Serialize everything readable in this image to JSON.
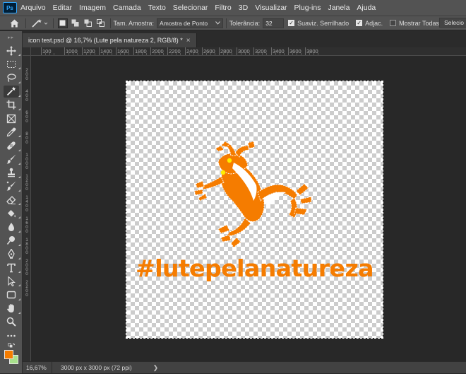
{
  "menubar": {
    "logo": "Ps",
    "items": [
      "Arquivo",
      "Editar",
      "Imagem",
      "Camada",
      "Texto",
      "Selecionar",
      "Filtro",
      "3D",
      "Visualizar",
      "Plug-ins",
      "Janela",
      "Ajuda"
    ]
  },
  "options": {
    "sample_size_label": "Tam. Amostra:",
    "sample_size_value": "Amostra de Ponto",
    "tolerance_label": "Tolerância:",
    "tolerance_value": "32",
    "antialias_label": "Suaviz. Serrilhado",
    "antialias_checked": true,
    "contiguous_label": "Adjac.",
    "contiguous_checked": true,
    "sample_all_label": "Mostrar Todas Camad.",
    "sample_all_checked": false,
    "select_subject_label": "Selecio"
  },
  "document_tab": {
    "title": "icon test.psd @ 16,7% (Lute pela natureza 2, RGB/8) *",
    "close_glyph": "×"
  },
  "tools": [
    {
      "name": "move-tool",
      "icon": "move-icon"
    },
    {
      "name": "marquee-tool",
      "icon": "marquee-icon"
    },
    {
      "name": "lasso-tool",
      "icon": "lasso-icon"
    },
    {
      "name": "magic-wand-tool",
      "icon": "magic-wand-icon",
      "active": true
    },
    {
      "name": "crop-tool",
      "icon": "crop-icon"
    },
    {
      "name": "frame-tool",
      "icon": "frame-icon"
    },
    {
      "name": "eyedropper-tool",
      "icon": "eyedropper-icon"
    },
    {
      "name": "healing-brush-tool",
      "icon": "bandage-icon"
    },
    {
      "name": "brush-tool",
      "icon": "brush-icon"
    },
    {
      "name": "clone-stamp-tool",
      "icon": "stamp-icon"
    },
    {
      "name": "history-brush-tool",
      "icon": "history-brush-icon"
    },
    {
      "name": "eraser-tool",
      "icon": "eraser-icon"
    },
    {
      "name": "paint-bucket-tool",
      "icon": "bucket-icon"
    },
    {
      "name": "blur-tool",
      "icon": "drop-icon"
    },
    {
      "name": "dodge-tool",
      "icon": "dodge-icon"
    },
    {
      "name": "pen-tool",
      "icon": "pen-icon"
    },
    {
      "name": "type-tool",
      "icon": "type-icon"
    },
    {
      "name": "path-selection-tool",
      "icon": "arrow-icon"
    },
    {
      "name": "shape-tool",
      "icon": "rectangle-icon"
    },
    {
      "name": "hand-tool",
      "icon": "hand-icon"
    },
    {
      "name": "zoom-tool",
      "icon": "zoom-icon"
    },
    {
      "name": "more-tools",
      "icon": "ellipsis-icon"
    }
  ],
  "colors": {
    "foreground": "#f57c00",
    "background": "#a8e08c",
    "accent": "#31a8ff",
    "artwork": "#f57c00"
  },
  "ruler_top": {
    "labels": [
      "100",
      "1000",
      "1200",
      "1400",
      "1600",
      "1800",
      "2000",
      "2200",
      "2400",
      "2600",
      "2800",
      "3000",
      "3200",
      "3400",
      "3600",
      "3800"
    ]
  },
  "ruler_left": {
    "labels": [
      "200",
      "400",
      "600",
      "800",
      "1000",
      "1200",
      "1400",
      "1600",
      "1800",
      "2000",
      "2200"
    ]
  },
  "artwork": {
    "hashtag": "#lutepelanatureza"
  },
  "status": {
    "zoom": "16,67%",
    "doc_info": "3000 px x 3000 px (72 ppi)",
    "arrow": "❯"
  }
}
